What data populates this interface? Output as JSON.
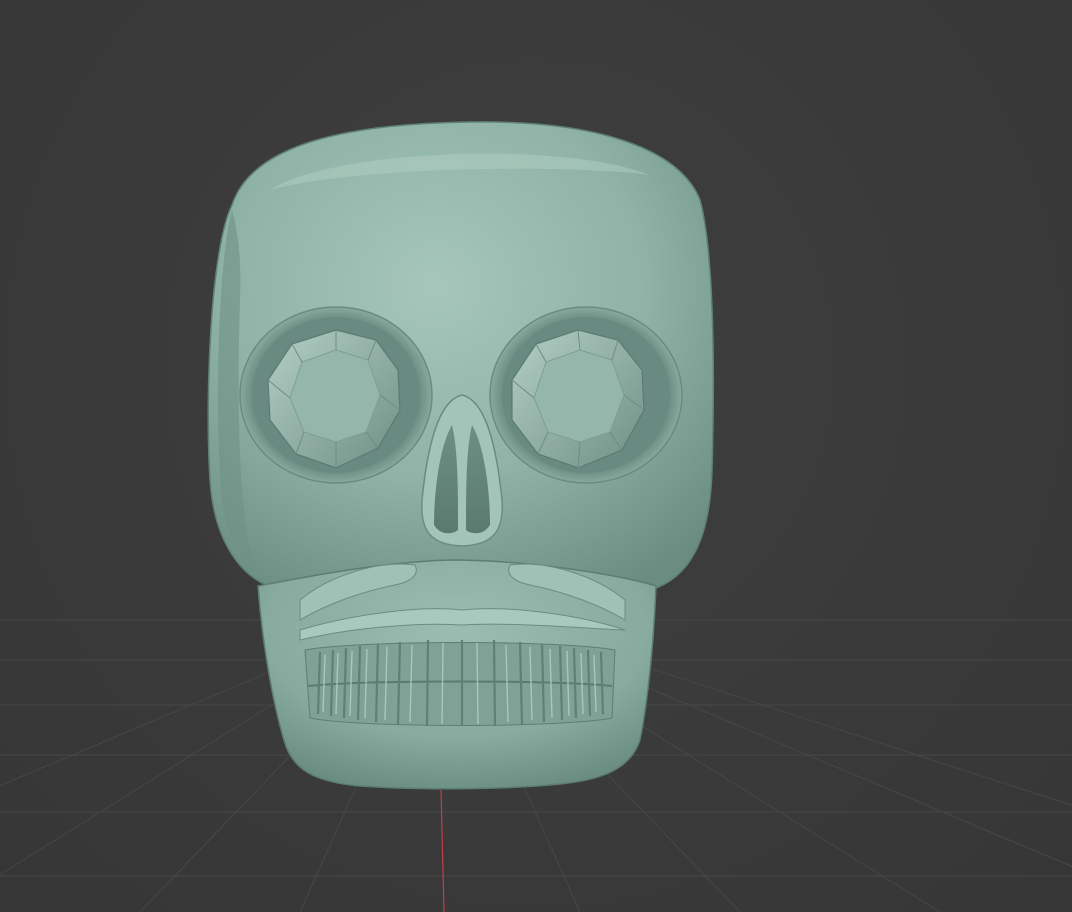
{
  "viewport": {
    "background_color": "#3a3a3a",
    "grid_color": "#4a4a4a",
    "axis_color": "#c0404a",
    "model": {
      "name": "skull",
      "material_color": "#8fb3a7",
      "eye_gem_color": "#8eaca2"
    }
  }
}
